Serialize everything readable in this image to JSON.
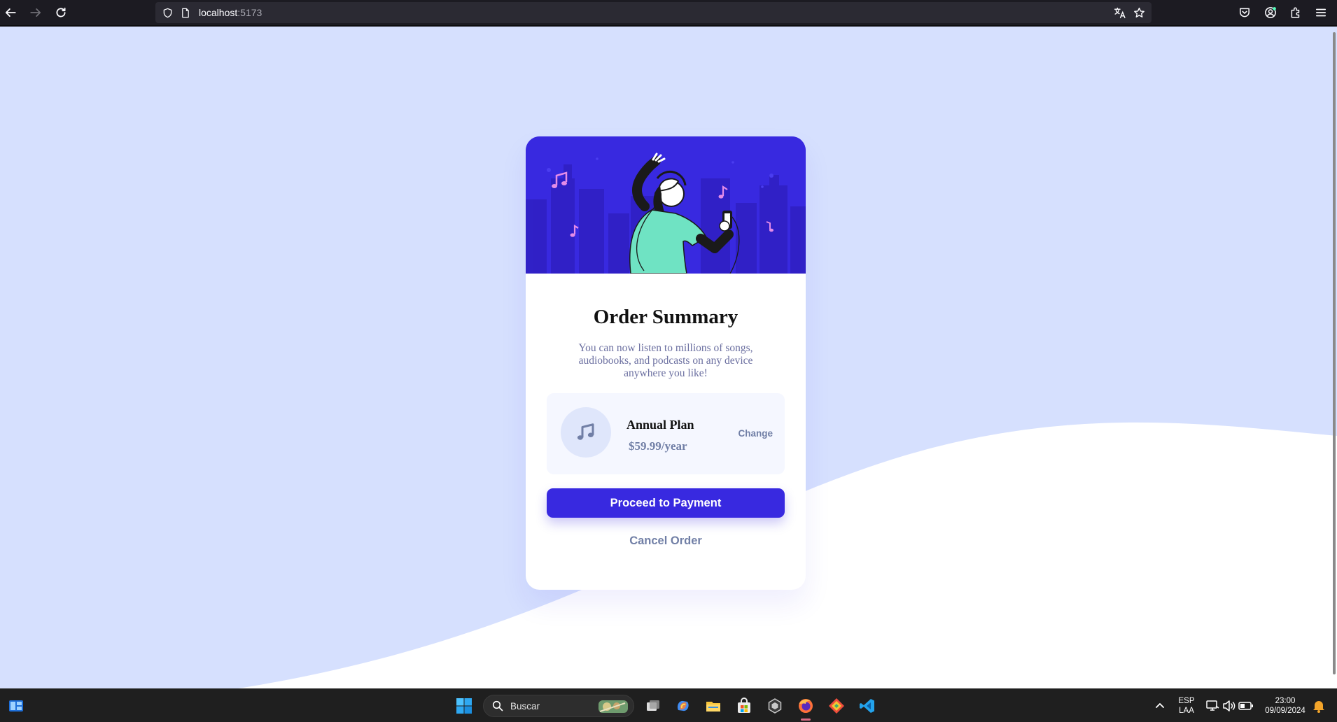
{
  "browser": {
    "url_host": "localhost",
    "url_port": ":5173"
  },
  "card": {
    "title": "Order Summary",
    "description": "You can now listen to millions of songs, audiobooks, and podcasts on any device anywhere you like!",
    "plan": {
      "name": "Annual Plan",
      "price": "$59.99/year",
      "change_label": "Change"
    },
    "pay_label": "Proceed to Payment",
    "cancel_label": "Cancel Order"
  },
  "colors": {
    "background": "#d6e0fe",
    "primary": "#3829e0",
    "muted": "#717fa6"
  },
  "taskbar": {
    "search_placeholder": "Buscar",
    "lang_top": "ESP",
    "lang_bottom": "LAA",
    "time": "23:00",
    "date": "09/09/2024"
  }
}
